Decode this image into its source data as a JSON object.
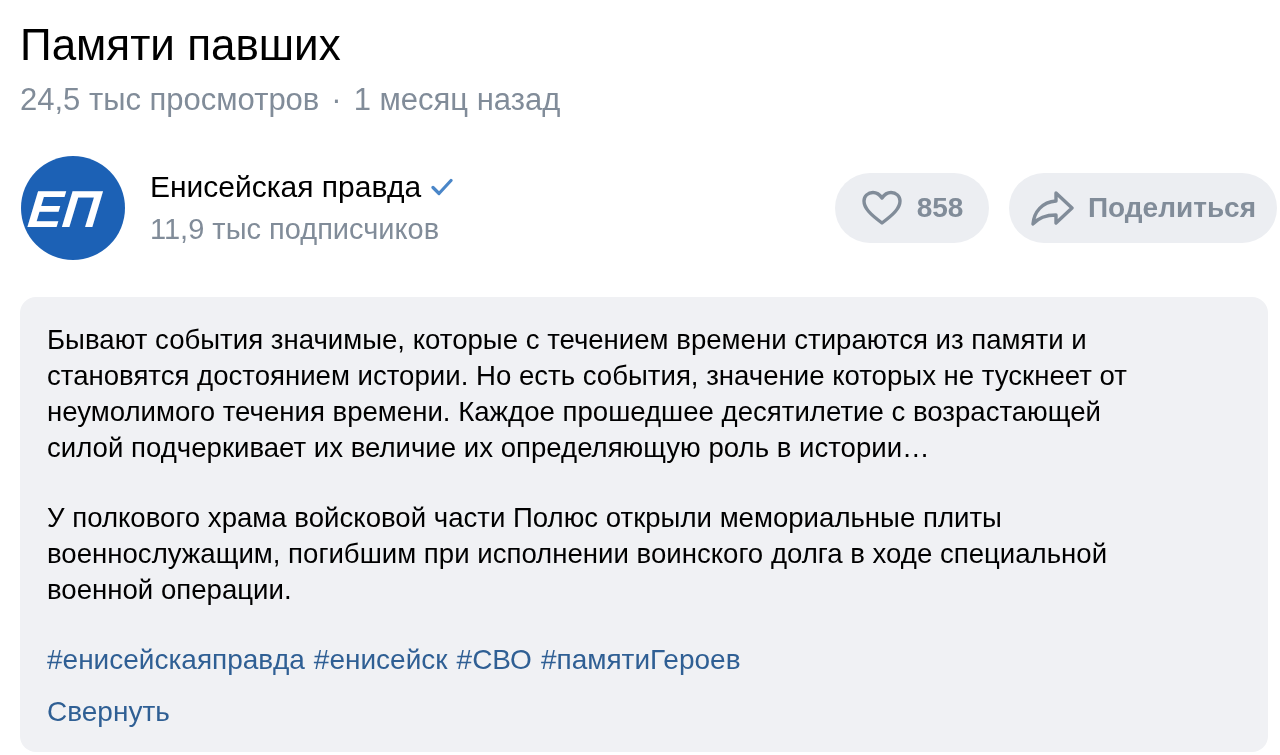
{
  "video": {
    "title": "Памяти павших",
    "views": "24,5 тыс просмотров",
    "separator": "·",
    "age": "1 месяц назад"
  },
  "channel": {
    "logo_text": "ЕП",
    "name": "Енисейская правда",
    "verified": true,
    "subscribers": "11,9 тыс подписчиков"
  },
  "actions": {
    "likes": "858",
    "share": "Поделиться"
  },
  "description": {
    "paragraphs": [
      "Бывают события значимые, которые с течением времени стираются из памяти и становятся достоянием истории. Но есть события, значение которых не тускнеет от неумолимого течения времени. Каждое прошедшее десятилетие с возрастающей силой подчеркивает их величие их определяющую роль в истории…",
      "У полкового храма войсковой части Полюс открыли мемориальные плиты военнослужащим, погибшим при исполнении воинского долга в ходе специальной военной операции."
    ],
    "hashtags": [
      "#енисейскаяправда",
      "#енисейск",
      "#СВО",
      "#памятиГероев"
    ],
    "collapse": "Свернуть"
  }
}
